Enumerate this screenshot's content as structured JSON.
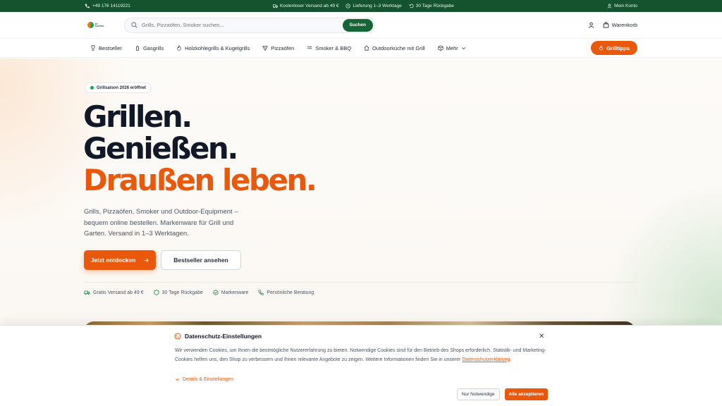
{
  "topbar": {
    "phone": "+49 176 14119221",
    "shipping": "Kostenloser Versand ab 49 €",
    "delivery": "Lieferung 1–3 Werktage",
    "returns": "30 Tage Rückgabe",
    "account": "Mein Konto"
  },
  "header": {
    "logo_text": "BY GARTEN",
    "search_placeholder": "Grills, Pizzaöfen, Smoker suchen...",
    "search_button": "Suchen",
    "cart_label": "Warenkorb"
  },
  "nav": {
    "items": [
      {
        "label": "Bestseller",
        "icon": "trophy-icon"
      },
      {
        "label": "Gasgrills",
        "icon": "gas-bottle-icon"
      },
      {
        "label": "Holzkohlegrills & Kugelgrills",
        "icon": "flame-icon"
      },
      {
        "label": "Pizzaöfen",
        "icon": "pizza-icon"
      },
      {
        "label": "Smoker & BBQ",
        "icon": "smoke-icon"
      },
      {
        "label": "Outdoorküche mit Grill",
        "icon": "house-icon"
      },
      {
        "label": "Mehr",
        "icon": "box-icon"
      }
    ],
    "tips_button": "Grilltipps"
  },
  "hero": {
    "badge": "Grillsaison 2026 eröffnet",
    "headline_line1": "Grillen.",
    "headline_line2": "Genießen.",
    "headline_line3": "Draußen leben.",
    "lead": "Grills, Pizzaöfen, Smoker und Outdoor-Equipment – bequem online bestellen. Markenware für Grill und Garten. Versand in 1–3 Werktagen.",
    "cta_primary": "Jetzt entdecken",
    "cta_secondary": "Bestseller ansehen",
    "trust": [
      {
        "label": "Gratis Versand ab 49 €",
        "icon": "truck-icon"
      },
      {
        "label": "30 Tage Rückgabe",
        "icon": "shield-icon"
      },
      {
        "label": "Markenware",
        "icon": "check-circle-icon"
      },
      {
        "label": "Persönliche Beratung",
        "icon": "phone-icon"
      }
    ]
  },
  "cookie": {
    "title": "Datenschutz-Einstellungen",
    "text_before_link": "Wir verwenden Cookies, um Ihnen die bestmögliche Nutzererfahrung zu bieten. Notwendige Cookies sind für den Betrieb des Shops erforderlich. Statistik- und Marketing-Cookies helfen uns, den Shop zu verbessern und Ihnen relevante Angebote zu zeigen. Weitere Informationen finden Sie in unserer ",
    "link_text": "Datenschutzerklärung",
    "text_after_link": ".",
    "details_toggle": "Details & Einstellungen",
    "btn_necessary": "Nur Notwendige",
    "btn_accept": "Alle akzeptieren"
  },
  "colors": {
    "brand_green": "#14532d",
    "accent_orange": "#ea580c"
  }
}
